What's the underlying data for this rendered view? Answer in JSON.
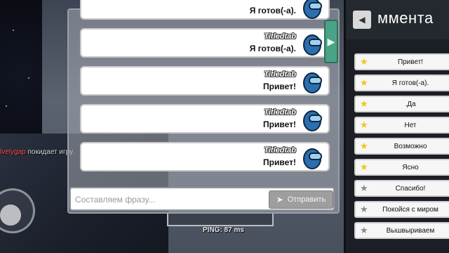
{
  "game": {
    "kill_feed": {
      "victim": "lvelygap",
      "action": "покидает игру."
    },
    "ping": "PING: 87 ms"
  },
  "chat": {
    "messages": [
      {
        "name": "",
        "text": "Я готов(-а)."
      },
      {
        "name": "Titledtab",
        "text": "Я готов(-а)."
      },
      {
        "name": "Titledtab",
        "text": "Привет!"
      },
      {
        "name": "Titledtab",
        "text": "Привет!"
      },
      {
        "name": "Titledtab",
        "text": "Привет!"
      }
    ],
    "input": {
      "placeholder": "Составляем фразу..."
    },
    "send_label": "Отправить",
    "toggle_icon": "chevron-right-icon",
    "avatar_color": "#2b6fb0"
  },
  "sidebar": {
    "title": "ммента",
    "phrases": [
      {
        "label": "Привет!",
        "favorite": true
      },
      {
        "label": "Я готов(-а).",
        "favorite": true
      },
      {
        "label": ".Да",
        "favorite": true
      },
      {
        "label": "Нет",
        "favorite": true
      },
      {
        "label": "Возможно",
        "favorite": true
      },
      {
        "label": "Ясно",
        "favorite": true
      },
      {
        "label": "Спасибо!",
        "favorite": false
      },
      {
        "label": "Покойся с миром",
        "favorite": false
      },
      {
        "label": "Вышвыриваем",
        "favorite": false
      }
    ],
    "colors": {
      "favorite_star": "#f2c41b",
      "plain_star": "#8a8a8a"
    }
  }
}
